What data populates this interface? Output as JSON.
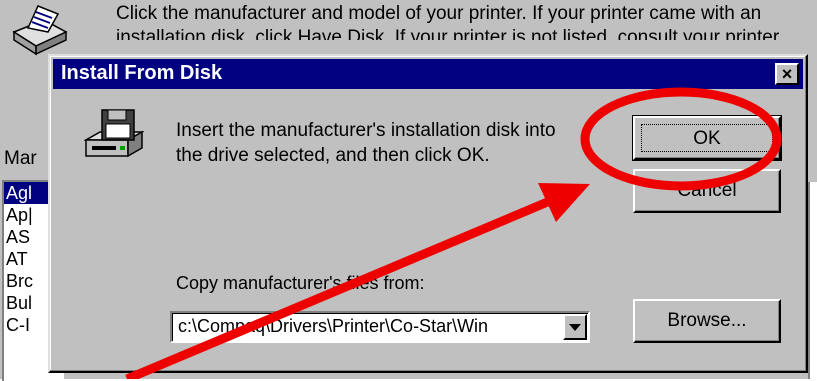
{
  "background": {
    "instructions_line1": "Click the manufacturer and model of your printer. If your printer came with an",
    "instructions_line2": "installation disk, click Have Disk. If your printer is not listed, consult your printer",
    "manufacturers_label": "Mar",
    "manufacturer_list": [
      "Agl",
      "Ap|",
      "AS",
      "AT",
      "Brc",
      "Bul",
      "C-I"
    ],
    "icon": "printer-setup-icon"
  },
  "dialog": {
    "title": "Install From Disk",
    "close_label": "×",
    "message_line1": "Insert the manufacturer's installation disk into",
    "message_line2": "the drive selected, and then click OK.",
    "ok_label": "OK",
    "cancel_label": "Cancel",
    "copy_label": "Copy manufacturer's files from:",
    "path_value": "c:\\Compaq\\Drivers\\Printer\\Co-Star\\Win",
    "browse_label": "Browse...",
    "icon": "floppy-disk-drive-icon"
  },
  "annotation": {
    "color": "#ee0000",
    "shapes": [
      "red-circle-around-ok",
      "red-arrow-to-ok"
    ]
  }
}
